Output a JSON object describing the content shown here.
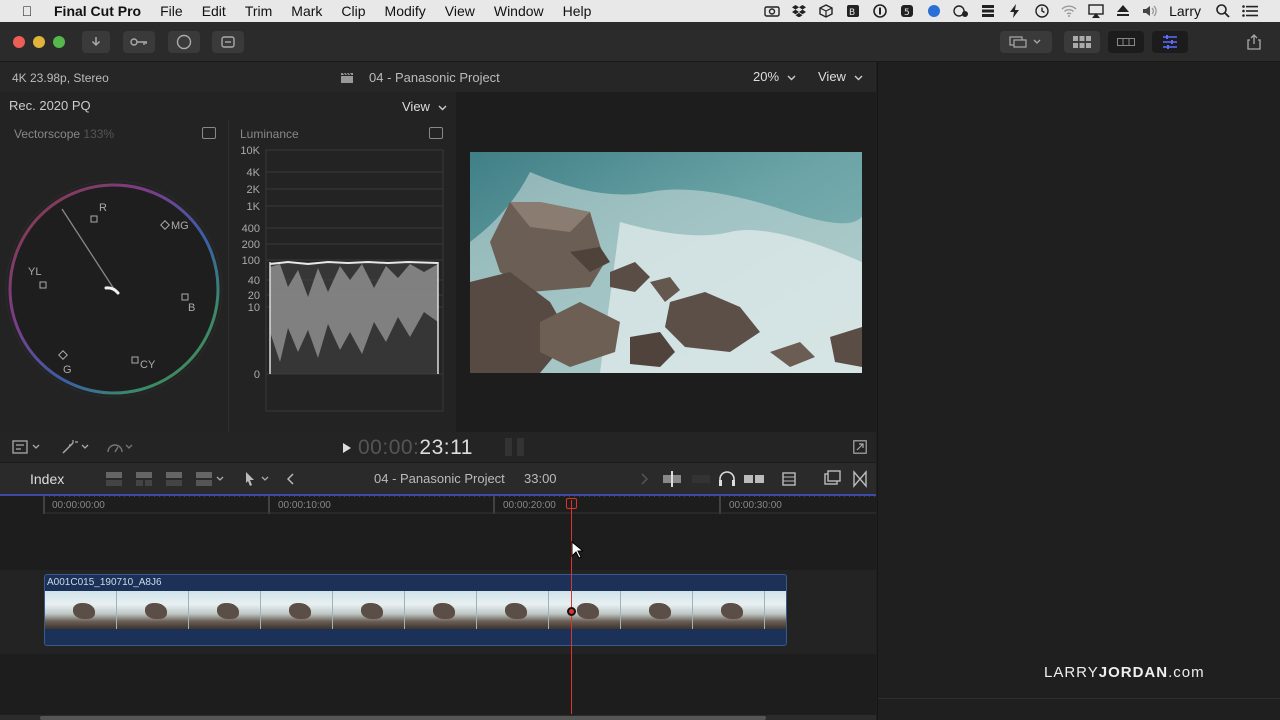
{
  "menubar": {
    "app_name": "Final Cut Pro",
    "items": [
      "File",
      "Edit",
      "Trim",
      "Mark",
      "Clip",
      "Modify",
      "View",
      "Window",
      "Help"
    ],
    "user": "Larry"
  },
  "viewer": {
    "format": "4K 23.98p, Stereo",
    "project": "04 - Panasonic Project",
    "zoom": "20%",
    "view_label": "View"
  },
  "scopes": {
    "color_space": "Rec. 2020 PQ",
    "view_label": "View",
    "vectorscope_label": "Vectorscope",
    "vectorscope_zoom": "133%",
    "vector_targets": [
      "R",
      "MG",
      "B",
      "CY",
      "G",
      "YL"
    ],
    "luminance_label": "Luminance",
    "luminance_scale": [
      "10K",
      "4K",
      "2K",
      "1K",
      "400",
      "200",
      "100",
      "40",
      "20",
      "10",
      "0"
    ]
  },
  "transport": {
    "timecode_dim": "00:00:",
    "timecode_bright": "23:11"
  },
  "timeline": {
    "index_label": "Index",
    "project": "04 - Panasonic Project",
    "duration": "33:00",
    "ruler": [
      "00:00:00:00",
      "00:00:10:00",
      "00:00:20:00",
      "00:00:30:00"
    ],
    "clip_name": "A001C015_190710_A8J6"
  },
  "watermark": {
    "part1": "LARRY",
    "part2": "JORDAN",
    "part3": ".com"
  },
  "colors": {
    "playhead": "#d9352b",
    "clip_blue": "#1b3158",
    "accent": "#5b6cff"
  }
}
